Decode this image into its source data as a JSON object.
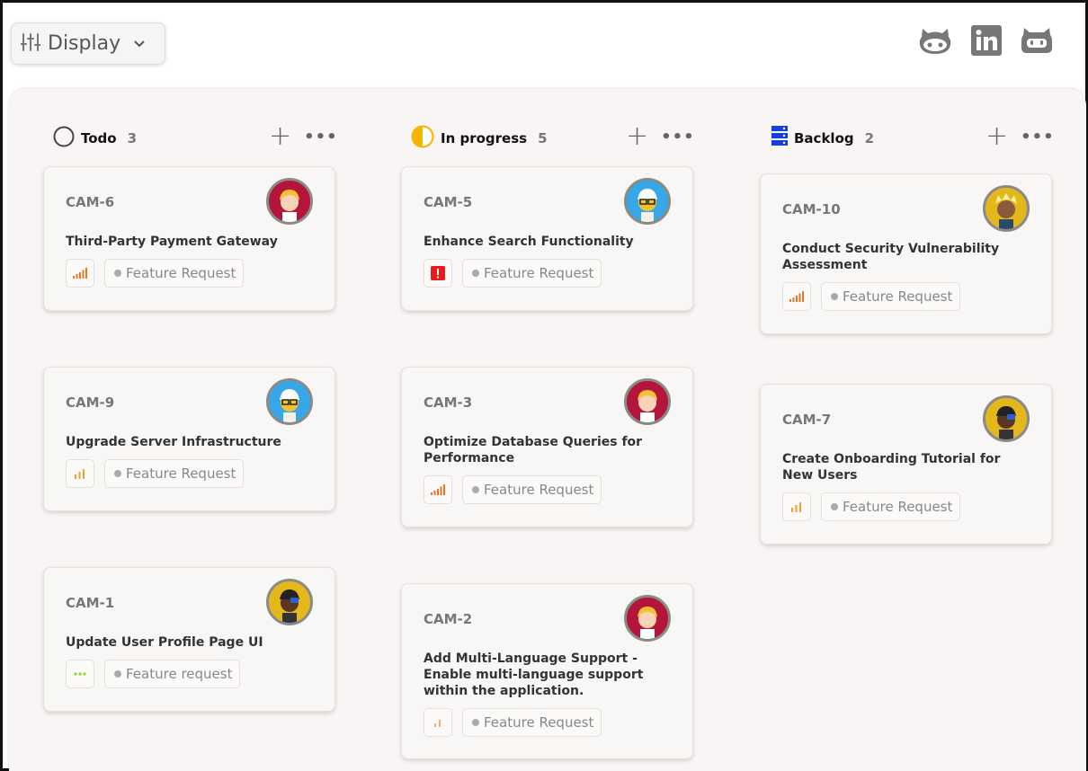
{
  "toolbar": {
    "display_label": "Display"
  },
  "social": [
    "github-icon",
    "linkedin-icon",
    "robot-icon"
  ],
  "columns": [
    {
      "title": "Todo",
      "count": "3",
      "status_icon": "circle-outline-icon"
    },
    {
      "title": "In progress",
      "count": "5",
      "status_icon": "half-circle-icon"
    },
    {
      "title": "Backlog",
      "count": "2",
      "status_icon": "server-stack-icon"
    }
  ],
  "colors": {
    "accent_progress": "#f5b400",
    "accent_backlog": "#1540d8",
    "priority_high": "#e8742a",
    "priority_medium": "#f0a030",
    "urgent": "#e61c1c",
    "no_priority": "#8bd72a"
  },
  "cards": {
    "cam6": {
      "id": "CAM-6",
      "title": "Third-Party Payment Gateway",
      "priority": "high-bars-icon",
      "tag": "Feature Request"
    },
    "cam9": {
      "id": "CAM-9",
      "title": "Upgrade Server Infrastructure",
      "priority": "medium-bars-icon",
      "tag": "Feature Request"
    },
    "cam1": {
      "id": "CAM-1",
      "title": "Update User Profile Page UI",
      "priority": "no-priority-icon",
      "tag": "Feature request"
    },
    "cam5": {
      "id": "CAM-5",
      "title": "Enhance Search Functionality",
      "priority": "urgent-icon",
      "tag": "Feature Request"
    },
    "cam3": {
      "id": "CAM-3",
      "title": "Optimize Database Queries for Performance",
      "priority": "high-bars-icon",
      "tag": "Feature Request"
    },
    "cam2": {
      "id": "CAM-2",
      "title": "Add Multi-Language Support - Enable multi-language support within the application.",
      "priority": "low-bars-icon",
      "tag": "Feature Request"
    },
    "cam10": {
      "id": "CAM-10",
      "title": "Conduct Security Vulnerability Assessment",
      "priority": "high-bars-icon",
      "tag": "Feature Request"
    },
    "cam7": {
      "id": "CAM-7",
      "title": "Create Onboarding Tutorial for New Users",
      "priority": "medium-bars-icon",
      "tag": "Feature Request"
    }
  }
}
